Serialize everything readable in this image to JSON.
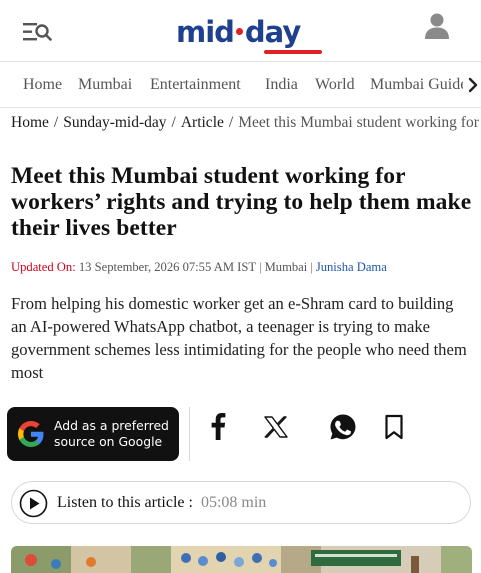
{
  "header": {
    "menu_icon": "menu-search-icon",
    "logo_text_left": "mid",
    "logo_text_right": "day",
    "logo_colors": {
      "text": "#1f3f8f",
      "accent": "#e01f26"
    },
    "user_icon": "user-icon"
  },
  "nav": {
    "items": [
      {
        "label": "Home"
      },
      {
        "label": "Mumbai"
      },
      {
        "label": "Entertainment"
      },
      {
        "label": "India"
      },
      {
        "label": "World"
      },
      {
        "label": "Mumbai Guide"
      }
    ],
    "more_icon": "chevron-right-icon"
  },
  "breadcrumb": {
    "items": [
      "Home",
      "Sunday-mid-day",
      "Article"
    ],
    "current": "Meet this Mumbai student working for workers’ rights and trying to help them make their lives better"
  },
  "article": {
    "title": "Meet this Mumbai student working for workers’ rights and trying to help them make their lives better",
    "updated_label": "Updated On:",
    "updated_value": "13 September, 2026 07:55 AM IST",
    "location": "Mumbai",
    "author": "Junisha Dama",
    "summary": "From helping his domestic worker get an e-Shram card to building an AI-powered WhatsApp chatbot, a teenager is trying to make government schemes less intimidating for the people who need them most"
  },
  "google_button": {
    "line1": "Add as a preferred",
    "line2": "source on Google",
    "icon": "google-g-icon"
  },
  "share": {
    "facebook_icon": "facebook-icon",
    "x_icon": "x-icon",
    "whatsapp_icon": "whatsapp-icon",
    "bookmark_icon": "bookmark-icon"
  },
  "listen": {
    "label": "Listen to this article :",
    "duration": "05:08 min",
    "icon": "play-icon"
  }
}
